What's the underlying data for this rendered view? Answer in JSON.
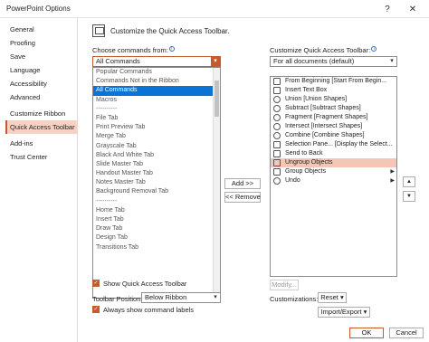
{
  "window": {
    "title": "PowerPoint Options",
    "help": "?",
    "close": "✕"
  },
  "nav": {
    "items": [
      {
        "label": "General"
      },
      {
        "label": "Proofing"
      },
      {
        "label": "Save"
      },
      {
        "label": "Language"
      },
      {
        "label": "Accessibility"
      },
      {
        "label": "Advanced"
      },
      {
        "label": "Customize Ribbon"
      },
      {
        "label": "Quick Access Toolbar",
        "active": true
      },
      {
        "label": "Add-ins"
      },
      {
        "label": "Trust Center"
      }
    ]
  },
  "header": {
    "text": "Customize the Quick Access Toolbar."
  },
  "left": {
    "choose_label": "Choose commands from:",
    "choose_value": "All Commands",
    "dropdown_options": [
      "Popular Commands",
      "Commands Not in the Ribbon",
      "All Commands",
      "Macros",
      "----------",
      "File Tab",
      "Print Preview Tab",
      "Merge Tab",
      "Grayscale Tab",
      "Black And White Tab",
      "Slide Master Tab",
      "Handout Master Tab",
      "Notes Master Tab",
      "Background Removal Tab",
      "----------",
      "Home Tab",
      "Insert Tab",
      "Draw Tab",
      "Design Tab",
      "Transitions Tab"
    ],
    "selected_option": "All Commands",
    "show_below_label": "Show Quick Access Toolbar",
    "position_label": "Toolbar Position",
    "position_value": "Below Ribbon",
    "always_show_label": "Always show command labels"
  },
  "right": {
    "customize_label": "Customize Quick Access Toolbar:",
    "customize_value": "For all documents (default)",
    "items": [
      {
        "label": "From Beginning [Start From Begin...",
        "icon": "slideshow-icon"
      },
      {
        "label": "Insert Text Box",
        "icon": "textbox-icon"
      },
      {
        "label": "Union [Union Shapes]",
        "icon": "union-icon"
      },
      {
        "label": "Subtract [Subtract Shapes]",
        "icon": "subtract-icon"
      },
      {
        "label": "Fragment [Fragment Shapes]",
        "icon": "fragment-icon"
      },
      {
        "label": "Intersect [Intersect Shapes]",
        "icon": "intersect-icon"
      },
      {
        "label": "Combine [Combine Shapes]",
        "icon": "combine-icon"
      },
      {
        "label": "Selection Pane... [Display the Select...",
        "icon": "selection-pane-icon"
      },
      {
        "label": "Send to Back",
        "icon": "send-back-icon"
      },
      {
        "label": "Ungroup Objects",
        "icon": "ungroup-icon",
        "selected": true
      },
      {
        "label": "Group Objects",
        "icon": "group-icon",
        "expander": true
      },
      {
        "label": "Undo",
        "icon": "undo-icon",
        "expander": true
      }
    ],
    "modify_label": "Modify...",
    "customizations_label": "Customizations:",
    "reset_label": "Reset ▾",
    "import_export_label": "Import/Export ▾"
  },
  "middle": {
    "add_label": "Add >>",
    "remove_label": "<< Remove"
  },
  "footer": {
    "ok_label": "OK",
    "cancel_label": "Cancel"
  },
  "colors": {
    "accent": "#c55a2b",
    "selection_blue": "#0a74d6",
    "selection_peach": "#f4c6b6"
  }
}
